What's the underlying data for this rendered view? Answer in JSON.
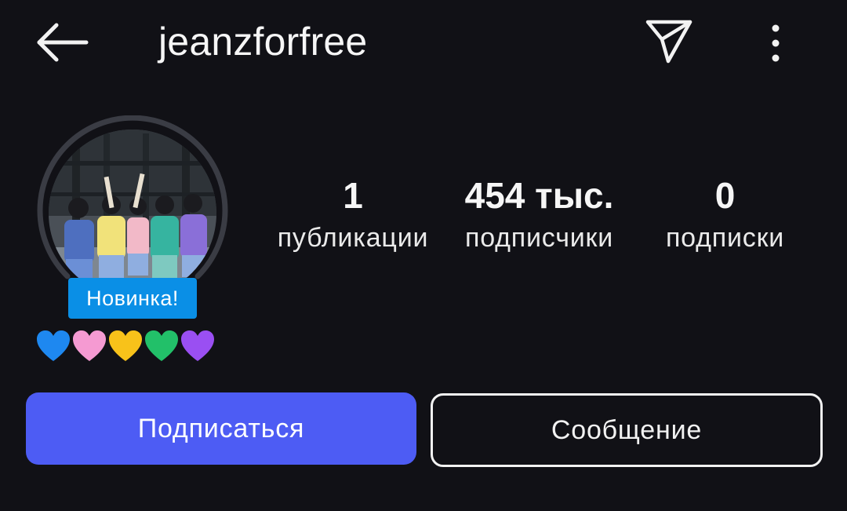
{
  "header": {
    "username": "jeanzforfree"
  },
  "profile": {
    "badge": "Новинка!",
    "bio_hearts": [
      "blue-heart",
      "pink-heart",
      "yellow-heart",
      "green-heart",
      "purple-heart"
    ]
  },
  "stats": {
    "posts": {
      "value": "1",
      "label": "публикации"
    },
    "followers": {
      "value": "454 тыс.",
      "label": "подписчики"
    },
    "following": {
      "value": "0",
      "label": "подписки"
    }
  },
  "actions": {
    "follow_label": "Подписаться",
    "message_label": "Сообщение"
  },
  "colors": {
    "background": "#111116",
    "follow_button": "#4d5cf4",
    "badge": "#0a8fe6",
    "heart_blue": "#1e88f0",
    "heart_pink": "#f59ad2",
    "heart_yellow": "#f8c21a",
    "heart_green": "#22c069",
    "heart_purple": "#9a4ff2"
  }
}
